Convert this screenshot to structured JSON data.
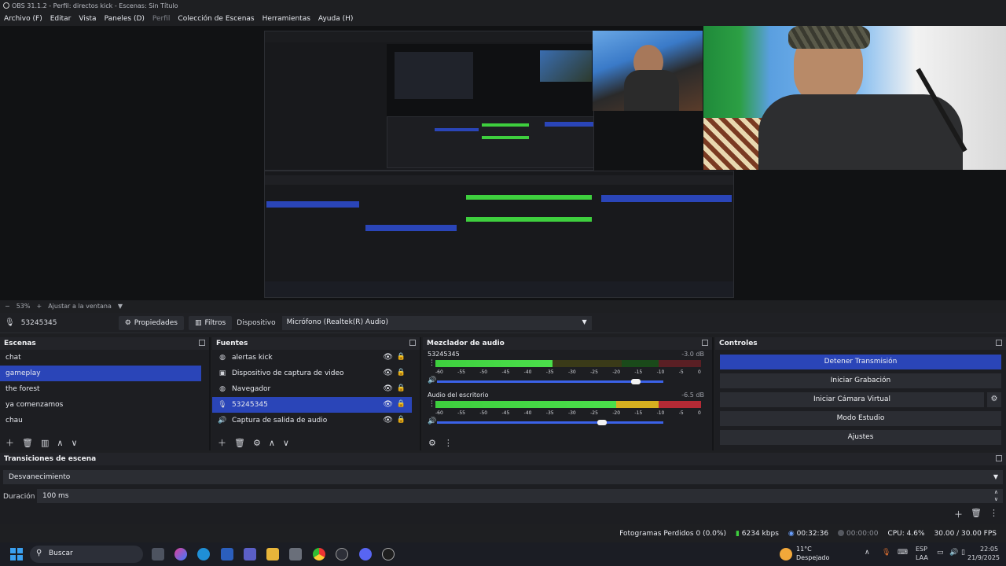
{
  "window": {
    "title": "OBS 31.1.2 - Perfil: directos kick - Escenas: Sin Título"
  },
  "menu": [
    {
      "label": "Archivo (F)",
      "dim": false
    },
    {
      "label": "Editar",
      "dim": false
    },
    {
      "label": "Vista",
      "dim": false
    },
    {
      "label": "Paneles (D)",
      "dim": false
    },
    {
      "label": "Perfil",
      "dim": true
    },
    {
      "label": "Colección de Escenas",
      "dim": false
    },
    {
      "label": "Herramientas",
      "dim": false
    },
    {
      "label": "Ayuda (H)",
      "dim": false
    }
  ],
  "preview": {
    "zoom": "53%",
    "fit_label": "Ajustar a la ventana"
  },
  "source_toolbar": {
    "source_name": "53245345",
    "properties_label": "Propiedades",
    "filters_label": "Filtros",
    "device_label": "Dispositivo",
    "device_value": "Micrófono (Realtek(R) Audio)"
  },
  "scenes": {
    "title": "Escenas",
    "items": [
      "chat",
      "gameplay",
      "the forest",
      "ya comenzamos",
      "chau"
    ],
    "selected": 1
  },
  "sources": {
    "title": "Fuentes",
    "items": [
      {
        "label": "alertas kick",
        "icon": "browser-icon"
      },
      {
        "label": "Dispositivo de captura de video",
        "icon": "camera-icon"
      },
      {
        "label": "Navegador",
        "icon": "browser-icon"
      },
      {
        "label": "53245345",
        "icon": "microphone-icon"
      },
      {
        "label": "Captura de salida de audio",
        "icon": "speaker-icon"
      }
    ],
    "selected": 3
  },
  "mixer": {
    "title": "Mezclador de audio",
    "channels": [
      {
        "name": "53245345",
        "db": "-3.0 dB",
        "volume": 0.88
      },
      {
        "name": "Audio del escritorio",
        "db": "-6.5 dB",
        "volume": 0.73
      }
    ],
    "ticks": [
      "-60",
      "-55",
      "-50",
      "-45",
      "-40",
      "-35",
      "-30",
      "-25",
      "-20",
      "-15",
      "-10",
      "-5",
      "0"
    ]
  },
  "controls": {
    "title": "Controles",
    "buttons": [
      "Detener Transmisión",
      "Iniciar Grabación",
      "Iniciar Cámara Virtual",
      "Modo Estudio",
      "Ajustes"
    ]
  },
  "transitions": {
    "title": "Transiciones de escena",
    "type": "Desvanecimiento",
    "duration_label": "Duración",
    "duration_value": "100 ms"
  },
  "status": {
    "dropped": "Fotogramas Perdidos 0 (0.0%)",
    "bitrate": "6234 kbps",
    "stream_time": "00:32:36",
    "rec_time": "00:00:00",
    "cpu": "CPU: 4.6%",
    "fps": "30.00 / 30.00 FPS"
  },
  "taskbar": {
    "search": "Buscar",
    "weather_temp": "11°C",
    "weather_desc": "Despejado",
    "lang": "ESP",
    "lang2": "LAA",
    "time": "22:05",
    "date": "21/9/2025"
  },
  "colors": {
    "accent": "#2a45b8",
    "meter_green": "#3ecf3e",
    "meter_yellow": "#d6b020",
    "meter_red": "#b52a35"
  }
}
